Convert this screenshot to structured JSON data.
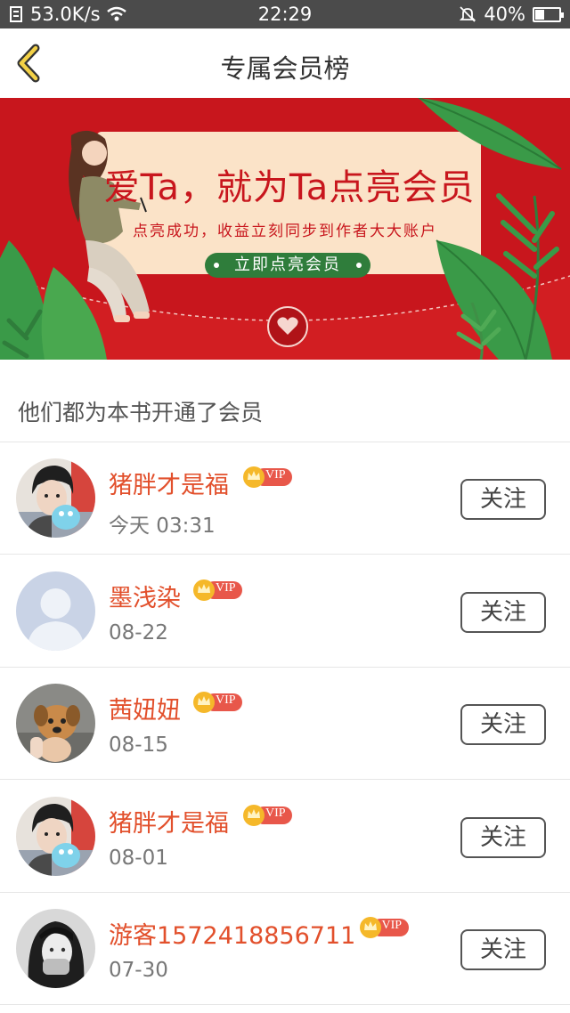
{
  "status_bar": {
    "speed": "53.0K/s",
    "time": "22:29",
    "battery": "40%",
    "battery_level": 0.4,
    "icons": [
      "data-icon",
      "wifi-icon",
      "mute-icon",
      "battery-icon"
    ]
  },
  "nav": {
    "back_icon": "chevron-left-icon",
    "title": "专属会员榜"
  },
  "banner": {
    "title": "爱Ta，就为Ta点亮会员",
    "subtitle": "点亮成功，收益立刻同步到作者大大账户",
    "button": "立即点亮会员",
    "colors": {
      "background": "#c8161d",
      "card": "#fbe3c8",
      "leaf": "#3a9a48",
      "button": "#2f7d3b"
    }
  },
  "section": {
    "title": "他们都为本书开通了会员"
  },
  "members": [
    {
      "name": "猪胖才是福",
      "date": "今天 03:31",
      "badge": "VIP",
      "follow": "关注",
      "avatar": "photo-boy"
    },
    {
      "name": "墨浅染",
      "date": "08-22",
      "badge": "VIP",
      "follow": "关注",
      "avatar": "default-avatar"
    },
    {
      "name": "茜妞妞",
      "date": "08-15",
      "badge": "VIP",
      "follow": "关注",
      "avatar": "photo-puppy"
    },
    {
      "name": "猪胖才是福",
      "date": "08-01",
      "badge": "VIP",
      "follow": "关注",
      "avatar": "photo-boy"
    },
    {
      "name": "游客1572418856711",
      "date": "07-30",
      "badge": "VIP",
      "follow": "关注",
      "avatar": "photo-girl"
    }
  ],
  "colors": {
    "name": "#e2502c",
    "vip": "#e8574a",
    "crown": "#f5b82a"
  }
}
